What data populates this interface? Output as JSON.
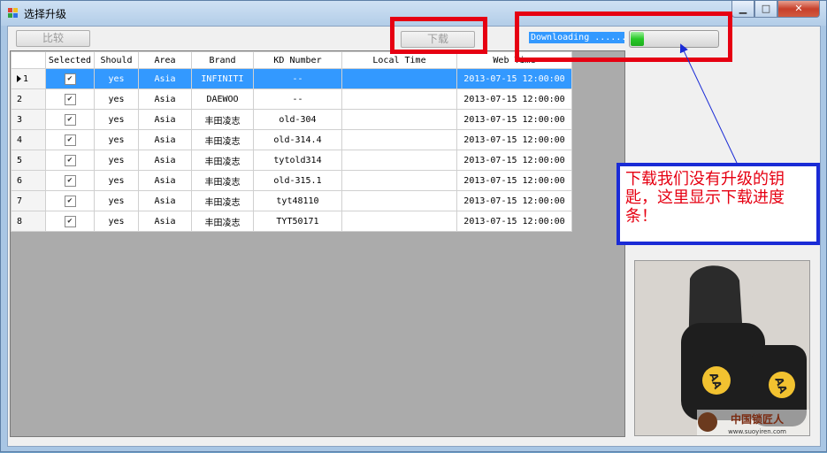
{
  "window": {
    "title": "选择升级",
    "minimize": "▁",
    "maximize": "□",
    "close": "✕"
  },
  "toolbar": {
    "compare_label": "比较",
    "download_label": "下载",
    "status_text": "Downloading ......",
    "progress_percent": 15
  },
  "table": {
    "headers": [
      "",
      "Selected",
      "Should",
      "Area",
      "Brand",
      "KD Number",
      "Local Time",
      "Web Time"
    ],
    "rows": [
      {
        "n": "1",
        "selected": true,
        "should": "yes",
        "area": "Asia",
        "brand": "INFINITI",
        "kd": "--",
        "local": "",
        "web": "2013-07-15 12:00:00"
      },
      {
        "n": "2",
        "selected": true,
        "should": "yes",
        "area": "Asia",
        "brand": "DAEWOO",
        "kd": "--",
        "local": "",
        "web": "2013-07-15 12:00:00"
      },
      {
        "n": "3",
        "selected": true,
        "should": "yes",
        "area": "Asia",
        "brand": "丰田凌志",
        "kd": "old-304",
        "local": "",
        "web": "2013-07-15 12:00:00"
      },
      {
        "n": "4",
        "selected": true,
        "should": "yes",
        "area": "Asia",
        "brand": "丰田凌志",
        "kd": "old-314.4",
        "local": "",
        "web": "2013-07-15 12:00:00"
      },
      {
        "n": "5",
        "selected": true,
        "should": "yes",
        "area": "Asia",
        "brand": "丰田凌志",
        "kd": "tytold314",
        "local": "",
        "web": "2013-07-15 12:00:00"
      },
      {
        "n": "6",
        "selected": true,
        "should": "yes",
        "area": "Asia",
        "brand": "丰田凌志",
        "kd": "old-315.1",
        "local": "",
        "web": "2013-07-15 12:00:00"
      },
      {
        "n": "7",
        "selected": true,
        "should": "yes",
        "area": "Asia",
        "brand": "丰田凌志",
        "kd": "tyt48110",
        "local": "",
        "web": "2013-07-15 12:00:00"
      },
      {
        "n": "8",
        "selected": true,
        "should": "yes",
        "area": "Asia",
        "brand": "丰田凌志",
        "kd": "TYT50171",
        "local": "",
        "web": "2013-07-15 12:00:00"
      }
    ]
  },
  "annotation": {
    "text": "下载我们没有升级的钥匙，这里显示下载进度条！"
  },
  "photo": {
    "key_label_1": "AA",
    "key_label_2": "AA",
    "watermark_cn": "中国锁匠人",
    "watermark_url": "www.suoyiren.com"
  },
  "colors": {
    "selection": "#3399ff",
    "annotation_red": "#e60012",
    "annotation_blue": "#1a2bd6",
    "progress_green": "#27c927"
  }
}
